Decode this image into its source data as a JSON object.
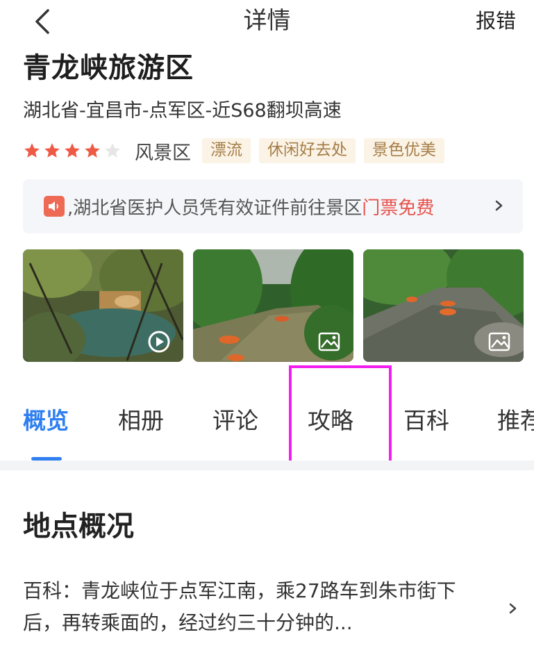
{
  "header": {
    "title": "详情",
    "report_label": "报错"
  },
  "place": {
    "name": "青龙峡旅游区",
    "address": "湖北省-宜昌市-点军区-近S68翻坝高速",
    "rating": 4,
    "rating_max": 5,
    "category": "风景区",
    "tags": [
      "漂流",
      "休闲好去处",
      "景色优美"
    ]
  },
  "notice": {
    "prefix": ",湖北省医护人员凭有效证件前往景区",
    "highlight": "门票免费"
  },
  "photos": [
    {
      "kind": "video",
      "icon": "play-icon"
    },
    {
      "kind": "image",
      "icon": "image-icon"
    },
    {
      "kind": "image",
      "icon": "image-icon"
    }
  ],
  "tabs": [
    "概览",
    "相册",
    "评论",
    "攻略",
    "百科",
    "推荐"
  ],
  "active_tab": "概览",
  "overview": {
    "title": "地点概况",
    "body": "百科：青龙峡位于点军江南，乘27路车到朱市街下后，再转乘面的，经过约三十分钟的..."
  },
  "colors": {
    "accent": "#2f7ff0",
    "star": "#ef5a45",
    "tag_text": "#a57d47",
    "highlight_box": "#f21ef0",
    "notice_highlight": "#e8504a"
  }
}
